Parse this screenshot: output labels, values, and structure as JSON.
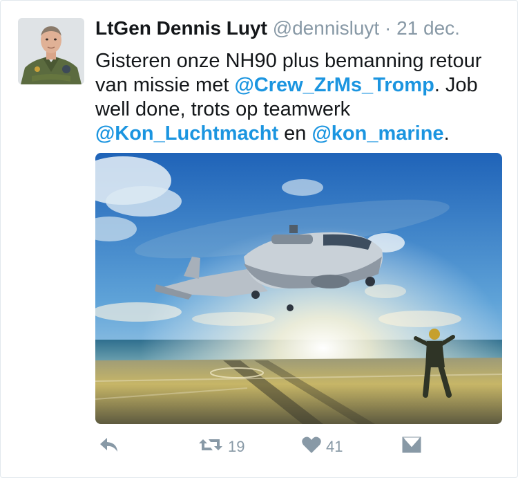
{
  "tweet": {
    "display_name": "LtGen Dennis Luyt",
    "handle": "@dennisluyt",
    "separator": "·",
    "date": "21 dec.",
    "text": {
      "part1": "Gisteren onze NH90 plus bemanning retour van missie met ",
      "mention1": "@Crew_ZrMs_Tromp",
      "part2": ". Job well done, trots op teamwerk ",
      "mention2": "@Kon_Luchtmacht",
      "part3": " en ",
      "mention3": "@kon_marine",
      "part4": "."
    },
    "actions": {
      "reply_icon": "reply-icon",
      "retweet_icon": "retweet-icon",
      "retweet_count": "19",
      "like_icon": "heart-icon",
      "like_count": "41",
      "dm_icon": "direct-message-icon"
    }
  },
  "colors": {
    "link": "#1b95e0",
    "muted": "#8899a6",
    "text": "#14171a",
    "border": "#e1e8ed"
  }
}
